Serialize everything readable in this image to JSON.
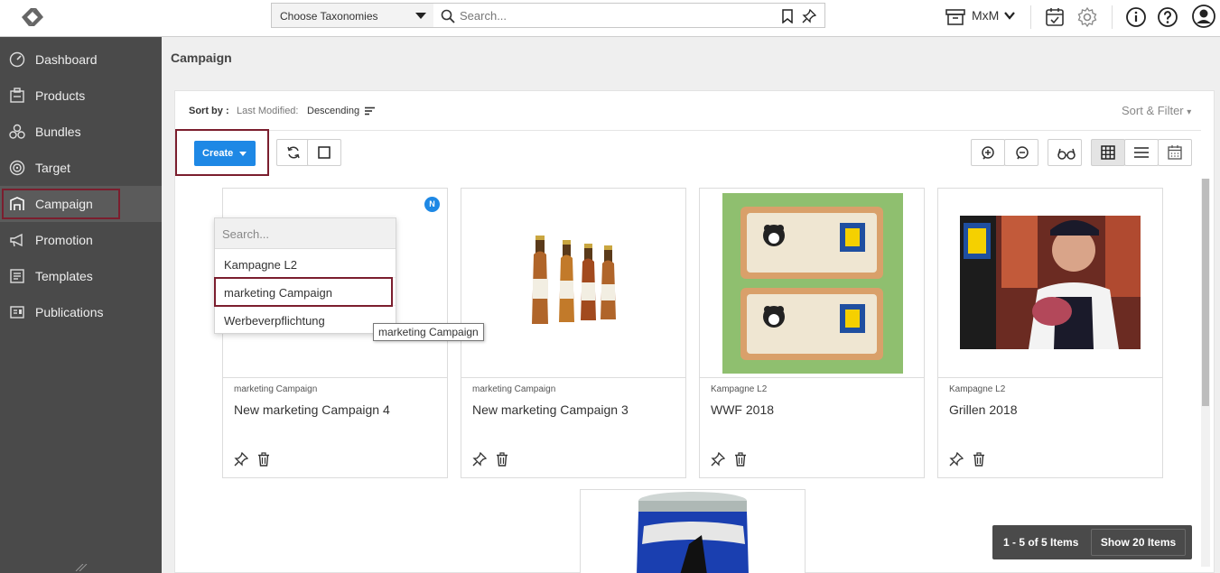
{
  "topbar": {
    "taxonomy_select": "Choose Taxonomies",
    "search_placeholder": "Search...",
    "workspace": "MxM"
  },
  "sidebar": {
    "items": [
      {
        "label": "Dashboard",
        "icon": "gauge-icon"
      },
      {
        "label": "Products",
        "icon": "product-box-icon"
      },
      {
        "label": "Bundles",
        "icon": "bundles-icon"
      },
      {
        "label": "Target",
        "icon": "target-icon"
      },
      {
        "label": "Campaign",
        "icon": "campaign-icon",
        "active": true
      },
      {
        "label": "Promotion",
        "icon": "megaphone-icon"
      },
      {
        "label": "Templates",
        "icon": "templates-icon"
      },
      {
        "label": "Publications",
        "icon": "publications-icon"
      }
    ]
  },
  "main": {
    "title": "Campaign",
    "sort": {
      "label": "Sort by :",
      "field": "Last Modified:",
      "direction": "Descending",
      "filter_label": "Sort & Filter"
    },
    "create_label": "Create",
    "dropdown": {
      "search_placeholder": "Search...",
      "items": [
        "Kampagne L2",
        "marketing Campaign",
        "Werbeverpflichtung"
      ],
      "tooltip": "marketing Campaign"
    },
    "cards": [
      {
        "type": "marketing Campaign",
        "name": "New marketing Campaign 4",
        "badge": "N"
      },
      {
        "type": "marketing Campaign",
        "name": "New marketing Campaign 3"
      },
      {
        "type": "Kampagne L2",
        "name": "WWF 2018"
      },
      {
        "type": "Kampagne L2",
        "name": "Grillen 2018"
      }
    ],
    "pager": {
      "info": "1 - 5 of 5 Items",
      "show_label": "Show 20 Items"
    }
  },
  "colors": {
    "accent": "#1e88e5",
    "sidebar": "#4a4a4a",
    "highlight": "#7b1e2e"
  }
}
